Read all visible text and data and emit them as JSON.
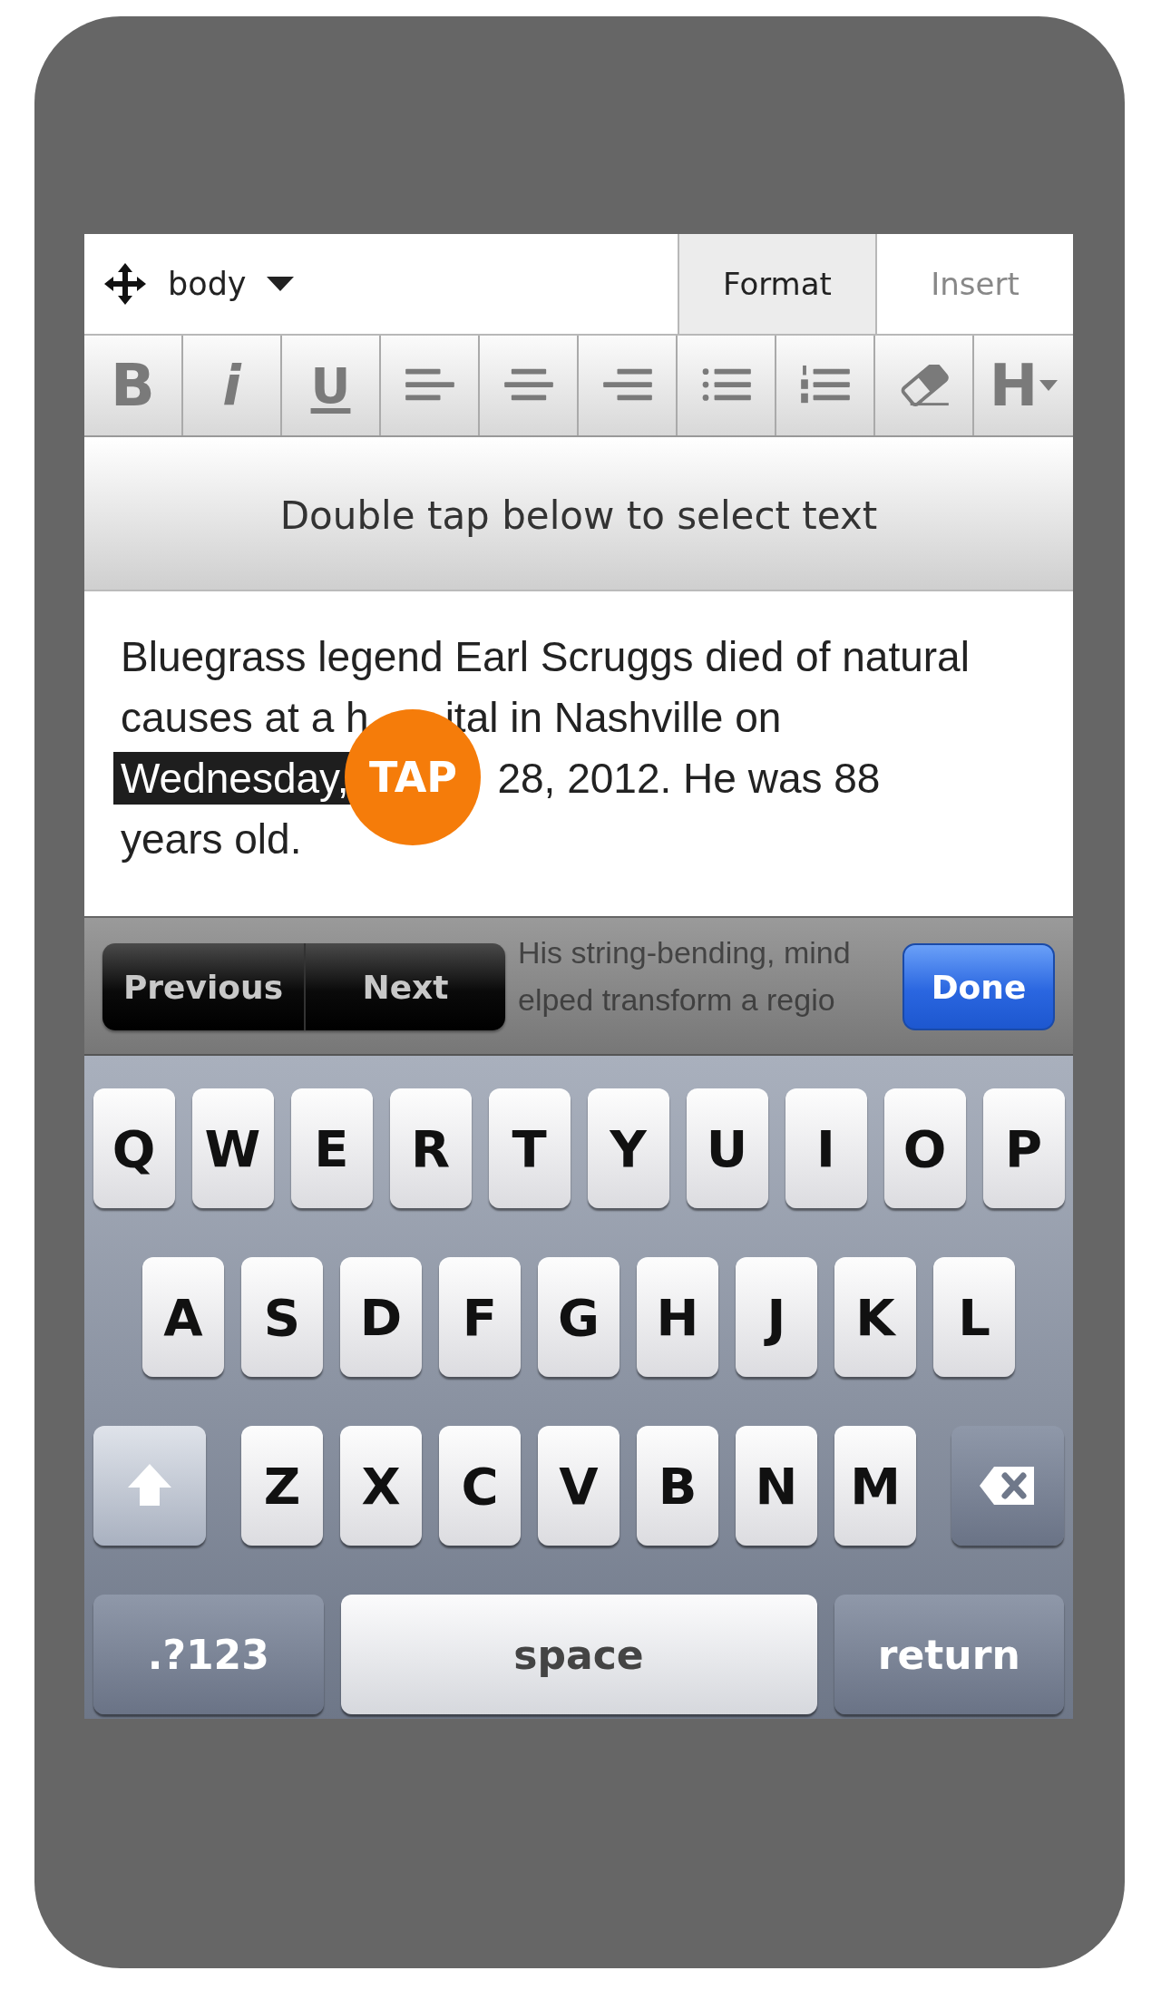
{
  "header": {
    "block_format": {
      "label": "body"
    },
    "tabs": [
      {
        "label": "Format",
        "selected": true
      },
      {
        "label": "Insert",
        "selected": false
      }
    ]
  },
  "toolbar": [
    {
      "kind": "bold",
      "label": "B"
    },
    {
      "kind": "italic",
      "label": "i"
    },
    {
      "kind": "underline",
      "label": "U"
    },
    {
      "kind": "align-left"
    },
    {
      "kind": "align-center"
    },
    {
      "kind": "align-right"
    },
    {
      "kind": "bullet-list"
    },
    {
      "kind": "numbered-list"
    },
    {
      "kind": "eraser"
    },
    {
      "kind": "heading",
      "label": "H"
    }
  ],
  "banner": "Double tap below to select text",
  "article": [
    {
      "segments": [
        {
          "kind": "text",
          "text": "Bluegrass legend Earl Scruggs died of natural",
          "selected": false
        }
      ]
    },
    {
      "segments": [
        {
          "kind": "text",
          "text": "causes at a h",
          "selected": false
        },
        {
          "kind": "gap"
        },
        {
          "kind": "text",
          "text": "ital in Nashville on",
          "selected": false
        }
      ]
    },
    {
      "segments": [
        {
          "kind": "text",
          "text": "Wednesday,",
          "selected": true
        },
        {
          "kind": "gap"
        },
        {
          "kind": "text",
          "text": "28, 2012. He was 88",
          "selected": false
        }
      ]
    },
    {
      "segments": [
        {
          "kind": "text",
          "text": "years old.",
          "selected": false
        }
      ]
    }
  ],
  "tap_marker": {
    "label": "TAP"
  },
  "form_bar": {
    "behind_text": [
      "His string-bending, mind",
      "elped transform a regio"
    ],
    "nav_buttons": [
      "Previous",
      "Next"
    ],
    "done": "Done"
  },
  "keyboard": [
    [
      {
        "kind": "char",
        "label": "Q"
      },
      {
        "kind": "char",
        "label": "W"
      },
      {
        "kind": "char",
        "label": "E"
      },
      {
        "kind": "char",
        "label": "R"
      },
      {
        "kind": "char",
        "label": "T"
      },
      {
        "kind": "char",
        "label": "Y"
      },
      {
        "kind": "char",
        "label": "U"
      },
      {
        "kind": "char",
        "label": "I"
      },
      {
        "kind": "char",
        "label": "O"
      },
      {
        "kind": "char",
        "label": "P"
      }
    ],
    [
      {
        "kind": "char",
        "label": "A"
      },
      {
        "kind": "char",
        "label": "S"
      },
      {
        "kind": "char",
        "label": "D"
      },
      {
        "kind": "char",
        "label": "F"
      },
      {
        "kind": "char",
        "label": "G"
      },
      {
        "kind": "char",
        "label": "H"
      },
      {
        "kind": "char",
        "label": "J"
      },
      {
        "kind": "char",
        "label": "K"
      },
      {
        "kind": "char",
        "label": "L"
      }
    ],
    [
      {
        "kind": "shift",
        "on": true
      },
      {
        "kind": "char",
        "label": "Z"
      },
      {
        "kind": "char",
        "label": "X"
      },
      {
        "kind": "char",
        "label": "C"
      },
      {
        "kind": "char",
        "label": "V"
      },
      {
        "kind": "char",
        "label": "B"
      },
      {
        "kind": "char",
        "label": "N"
      },
      {
        "kind": "char",
        "label": "M"
      },
      {
        "kind": "backspace"
      }
    ],
    [
      {
        "kind": "mode",
        "label": ".?123"
      },
      {
        "kind": "space",
        "label": "space"
      },
      {
        "kind": "return",
        "label": "return"
      }
    ]
  ]
}
